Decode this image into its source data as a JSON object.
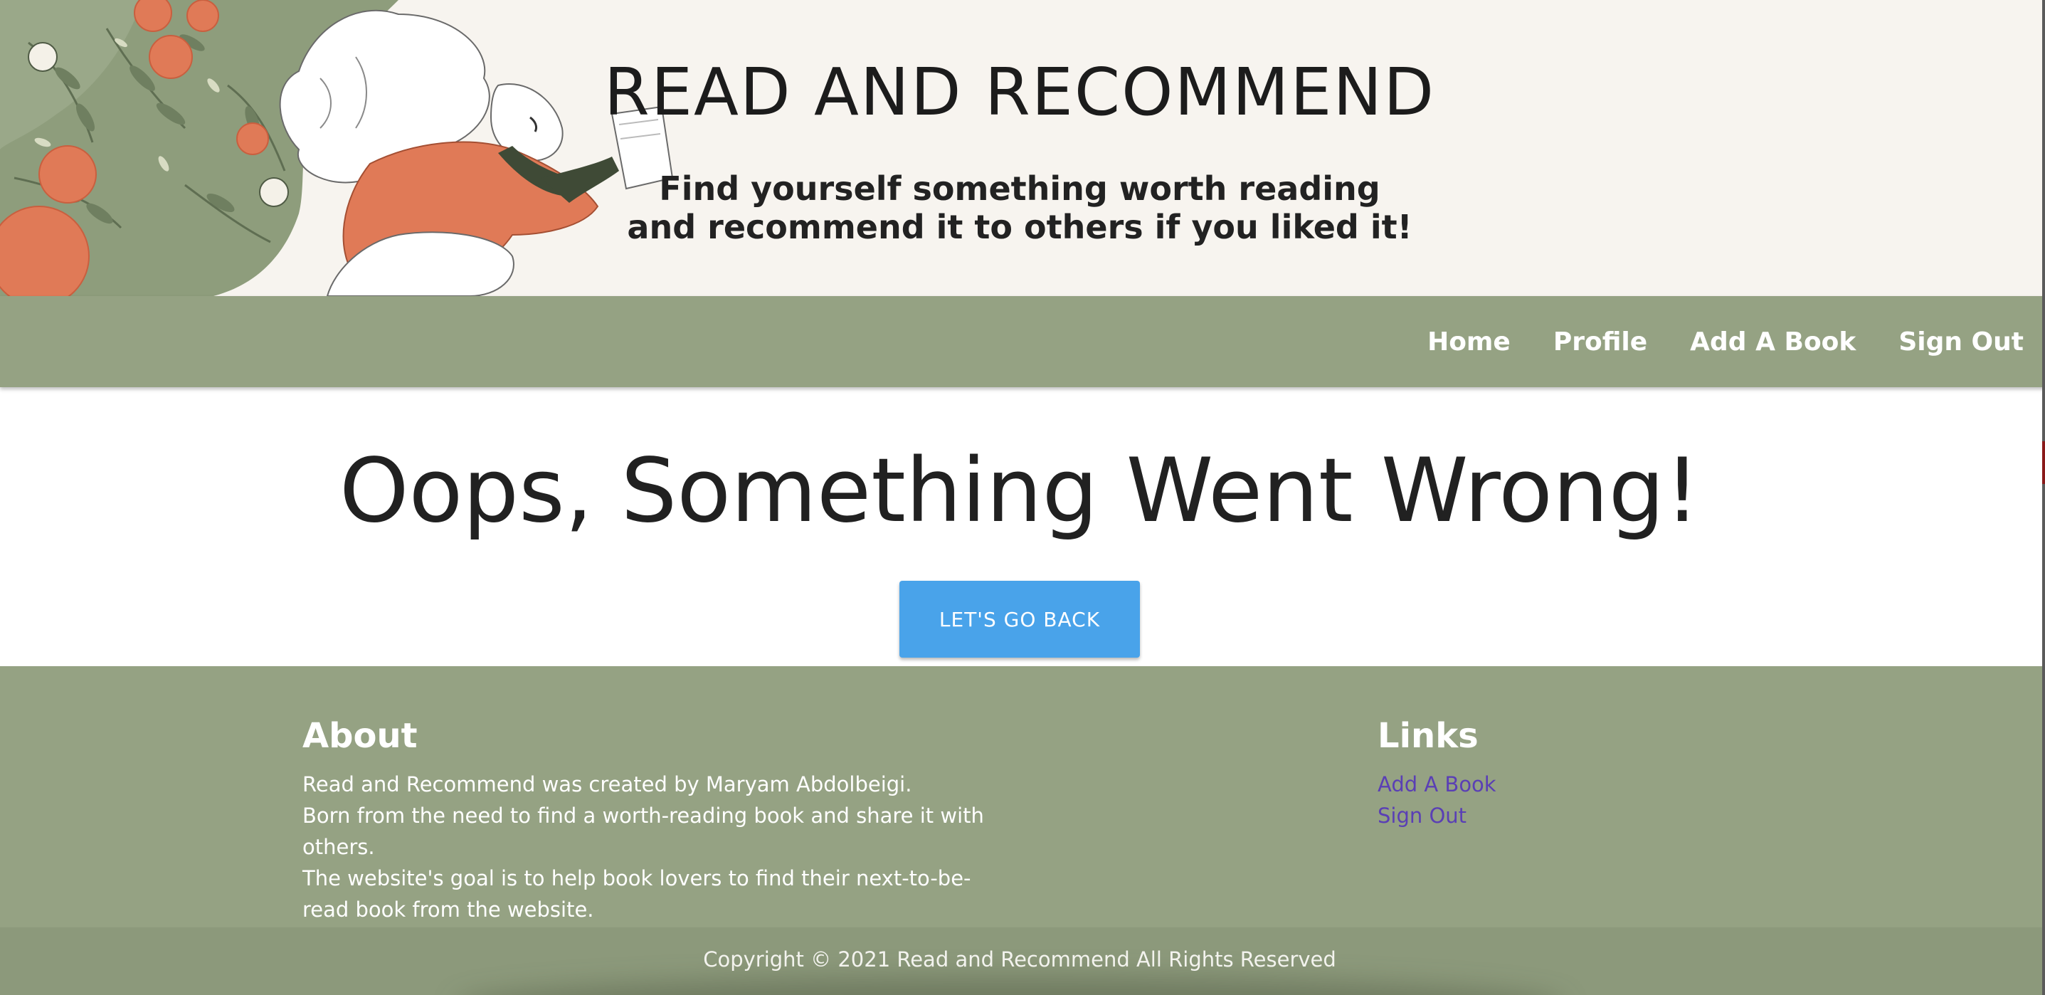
{
  "header": {
    "title": "READ AND RECOMMEND",
    "tagline_line1": "Find yourself something worth reading",
    "tagline_line2": "and recommend it to others if you liked it!",
    "illustration_icon": "woman-reading-book-illustration",
    "colors": {
      "background": "#f7f4ef",
      "leaf_green": "#8a9a7a",
      "flower_orange": "#e07a57",
      "sweater_orange": "#e07a57"
    }
  },
  "nav": {
    "items": [
      {
        "label": "Home"
      },
      {
        "label": "Profile"
      },
      {
        "label": "Add A Book"
      },
      {
        "label": "Sign Out"
      }
    ],
    "background": "#95a283"
  },
  "main": {
    "heading": "Oops, Something Went Wrong!",
    "button_label": "LET'S GO BACK",
    "button_color": "#49a3ea"
  },
  "footer": {
    "about": {
      "heading": "About",
      "lines": [
        "Read and Recommend was created by Maryam Abdolbeigi.",
        "Born from the need to find a worth-reading book and share it with others.",
        "The website's goal is to help book lovers to find their next-to-be-read book from the website."
      ]
    },
    "links": {
      "heading": "Links",
      "items": [
        {
          "label": "Add A Book"
        },
        {
          "label": "Sign Out"
        }
      ],
      "link_color": "#5a3fb5"
    },
    "copyright": "Copyright © 2021 Read and Recommend All Rights Reserved",
    "background": "#95a283"
  }
}
